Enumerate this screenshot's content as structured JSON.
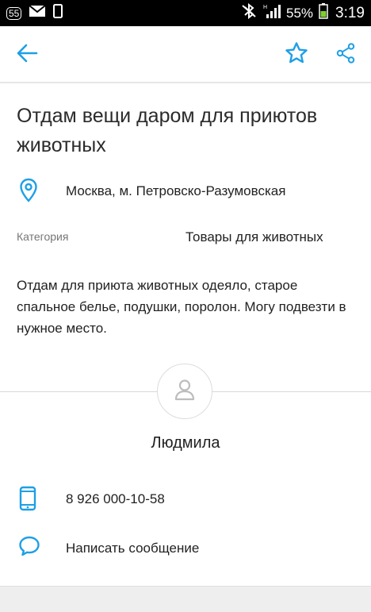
{
  "statusbar": {
    "badge": "55",
    "battery_percent": "55%",
    "time": "3:19",
    "icons": [
      "mail-icon",
      "phone-device-icon",
      "bluetooth-off-icon",
      "signal-icon",
      "battery-icon"
    ]
  },
  "toolbar": {
    "back_icon": "arrow-left-icon",
    "favorite_icon": "star-outline-icon",
    "share_icon": "share-icon",
    "accent_color": "#1e9fe6"
  },
  "listing": {
    "title": "Отдам вещи даром для приютов животных",
    "location": "Москва, м. Петровско-Разумовская",
    "category_label": "Категория",
    "category_value": "Товары для животных",
    "description": "Отдам для приюта животных одеяло, старое спальное белье, подушки, поролон. Могу подвезти в нужное место."
  },
  "seller": {
    "name": "Людмила",
    "phone": "8 926 000-10-58",
    "message_label": "Написать сообщение"
  }
}
